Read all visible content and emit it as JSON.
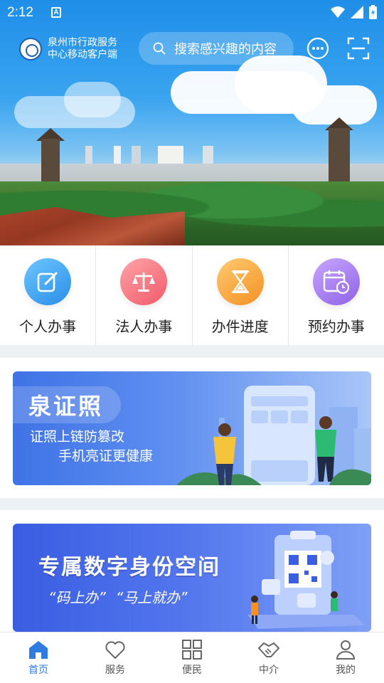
{
  "status_bar": {
    "time": "2:12",
    "notification_badge": "A"
  },
  "header": {
    "brand_line1": "泉州市行政服务",
    "brand_line2": "中心移动客户端",
    "search_placeholder": "搜索感兴趣的内容"
  },
  "quick_menu": [
    {
      "label": "个人办事",
      "icon": "edit-icon",
      "color": "#2b8ee8"
    },
    {
      "label": "法人办事",
      "icon": "scale-icon",
      "color": "#f05b6a"
    },
    {
      "label": "办件进度",
      "icon": "hourglass-icon",
      "color": "#f39124"
    },
    {
      "label": "预约办事",
      "icon": "calendar-clock-icon",
      "color": "#8f62e6"
    }
  ],
  "banner_license": {
    "title": "泉证照",
    "line1": "证照上链防篡改",
    "line2": "手机亮证更健康"
  },
  "banner_identity": {
    "title": "专属数字身份空间",
    "slogan1": "“码上办”",
    "slogan2": "“马上就办”"
  },
  "tabbar": {
    "active": "首页",
    "accent": "#2f7ce0",
    "items": [
      {
        "label": "首页",
        "icon": "home-icon"
      },
      {
        "label": "服务",
        "icon": "heart-icon"
      },
      {
        "label": "便民",
        "icon": "grid-icon"
      },
      {
        "label": "中介",
        "icon": "handshake-icon"
      },
      {
        "label": "我的",
        "icon": "user-icon"
      }
    ]
  }
}
